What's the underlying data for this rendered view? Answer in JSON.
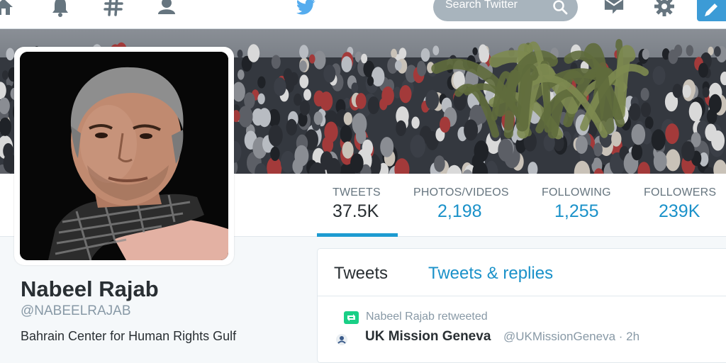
{
  "topnav": {
    "icons": [
      "home-icon",
      "bell-icon",
      "hashtag-icon",
      "person-icon",
      "twitter-bird-icon",
      "envelope-icon",
      "gear-icon",
      "compose-icon"
    ],
    "search_placeholder": "Search Twitter"
  },
  "profile_nav": {
    "stats": [
      {
        "label": "TWEETS",
        "value": "37.5K"
      },
      {
        "label": "PHOTOS/VIDEOS",
        "value": "2,198"
      },
      {
        "label": "FOLLOWING",
        "value": "1,255"
      },
      {
        "label": "FOLLOWERS",
        "value": "239K"
      }
    ],
    "active_stat": "TWEETS"
  },
  "profile": {
    "name": "Nabeel Rajab",
    "handle": "@NABEELRAJAB",
    "bio_partial": "Bahrain Center for Human Rights Gulf"
  },
  "timeline": {
    "tabs": [
      {
        "label": "Tweets"
      },
      {
        "label": "Tweets & replies"
      }
    ],
    "first_tweet": {
      "retweet_context": "Nabeel Rajab retweeted",
      "author_name": "UK Mission Geneva",
      "author_screenname": "@UKMissionGeneva · 2h"
    }
  },
  "colors": {
    "accent": "#1a91c9",
    "search_bg": "#a8b4bd",
    "nav_icon": "#66757f",
    "bird": "#55acee",
    "retweet_green": "#19cf86"
  }
}
